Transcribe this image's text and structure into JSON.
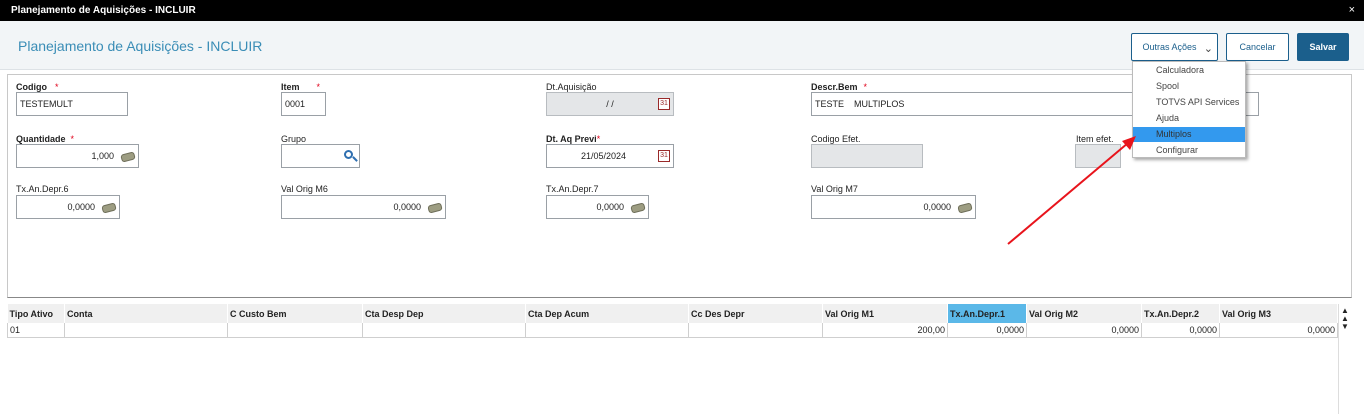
{
  "window": {
    "title": "Planejamento de Aquisições - INCLUIR",
    "close_glyph": "×"
  },
  "header": {
    "page_title": "Planejamento de Aquisições - INCLUIR",
    "outras_acoes": "Outras Ações",
    "cancelar": "Cancelar",
    "salvar": "Salvar"
  },
  "menu": {
    "items": [
      "Calculadora",
      "Spool",
      "TOTVS API Services",
      "Ajuda",
      "Multiplos",
      "Configurar"
    ],
    "selected": "Multiplos"
  },
  "form": {
    "codigo": {
      "label": "Codigo",
      "value": "TESTEMULT"
    },
    "item": {
      "label": "Item",
      "value": "0001"
    },
    "dt_aquisicao": {
      "label": "Dt.Aquisição",
      "value": "/ /"
    },
    "descr_bem": {
      "label": "Descr.Bem",
      "value": "TESTE    MULTIPLOS"
    },
    "quantidade": {
      "label": "Quantidade",
      "value": "1,000"
    },
    "grupo": {
      "label": "Grupo",
      "value": ""
    },
    "dt_aq_previ": {
      "label": "Dt. Aq Previ",
      "value": "21/05/2024"
    },
    "codigo_efet": {
      "label": "Codigo Efet.",
      "value": ""
    },
    "item_efet": {
      "label": "Item efet.",
      "value": ""
    },
    "tx_an_depr_6": {
      "label": "Tx.An.Depr.6",
      "value": "0,0000"
    },
    "val_orig_m6": {
      "label": "Val Orig M6",
      "value": "0,0000"
    },
    "tx_an_depr_7": {
      "label": "Tx.An.Depr.7",
      "value": "0,0000"
    },
    "val_orig_m7": {
      "label": "Val Orig M7",
      "value": "0,0000"
    },
    "required_mark": "*"
  },
  "grid": {
    "columns": [
      "Tipo Ativo",
      "Conta",
      "C Custo Bem",
      "Cta Desp Dep",
      "Cta Dep Acum",
      "Cc Des Depr",
      "Val Orig M1",
      "Tx.An.Depr.1",
      "Val Orig M2",
      "Tx.An.Depr.2",
      "Val Orig M3"
    ],
    "rows": [
      [
        "01",
        "",
        "",
        "",
        "",
        "",
        "200,00",
        "0,0000",
        "0,0000",
        "0,0000",
        "0,0000"
      ]
    ]
  },
  "colors": {
    "accent": "#1b5f8c",
    "title_blue": "#3a8db6",
    "highlight": "#5bb8e8",
    "arrow": "#e8141c"
  },
  "icons": [
    "calculator-icon",
    "calendar-icon",
    "search-icon",
    "chevron-down-icon",
    "close-icon"
  ]
}
